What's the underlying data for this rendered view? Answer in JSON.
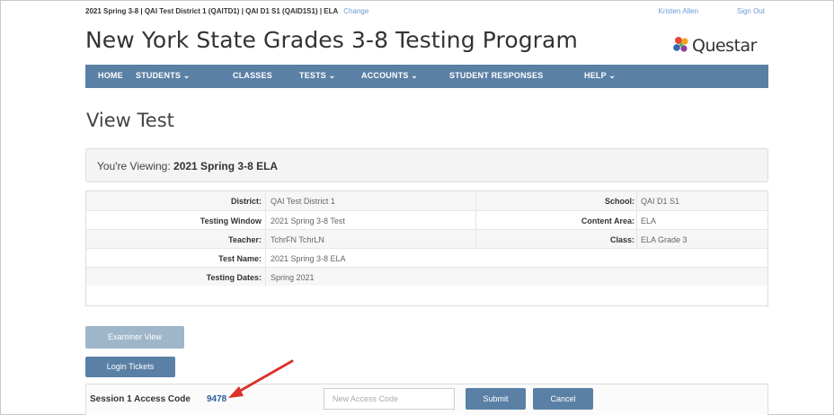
{
  "topbar": {
    "context": "2021 Spring 3-8  |  QAI Test District 1 (QAITD1)  |  QAI D1 S1 (QAID1S1)  |  ELA",
    "change_link": "Change",
    "user_name": "Kristen Allen",
    "sign_out": "Sign Out"
  },
  "header": {
    "app_title": "New York State Grades 3-8 Testing Program",
    "logo_text": "Questar"
  },
  "nav": {
    "items": [
      {
        "label": "HOME"
      },
      {
        "label": "STUDENTS ⌄"
      },
      {
        "label": "CLASSES"
      },
      {
        "label": "TESTS ⌄"
      },
      {
        "label": "ACCOUNTS ⌄"
      },
      {
        "label": "STUDENT RESPONSES"
      },
      {
        "label": "HELP ⌄"
      }
    ]
  },
  "page": {
    "title": "View Test",
    "viewing_label": "You're Viewing:",
    "viewing_value": "2021 Spring 3-8 ELA"
  },
  "details": {
    "district_label": "District:",
    "district_value": "QAI Test District 1",
    "school_label": "School:",
    "school_value": "QAI D1 S1",
    "window_label": "Testing Window",
    "window_value": "2021 Spring 3-8 Test",
    "content_label": "Content Area:",
    "content_value": "ELA",
    "teacher_label": "Teacher:",
    "teacher_value": "TchrFN TchrLN",
    "class_label": "Class:",
    "class_value": "ELA Grade 3",
    "testname_label": "Test Name:",
    "testname_value": "2021 Spring 3-8 ELA",
    "dates_label": "Testing Dates:",
    "dates_value": "Spring 2021"
  },
  "actions": {
    "examiner_view": "Examiner View",
    "login_tickets": "Login Tickets"
  },
  "access": {
    "label": "Session 1 Access Code",
    "code": "9478",
    "new_code_placeholder": "New Access Code",
    "submit": "Submit",
    "cancel": "Cancel"
  },
  "colors": {
    "nav_bg": "#5b80a5",
    "button_bg": "#5b80a5",
    "button_disabled_bg": "#9fb5ca",
    "link": "#6a9bd1",
    "annotation_arrow": "#d9322b"
  }
}
